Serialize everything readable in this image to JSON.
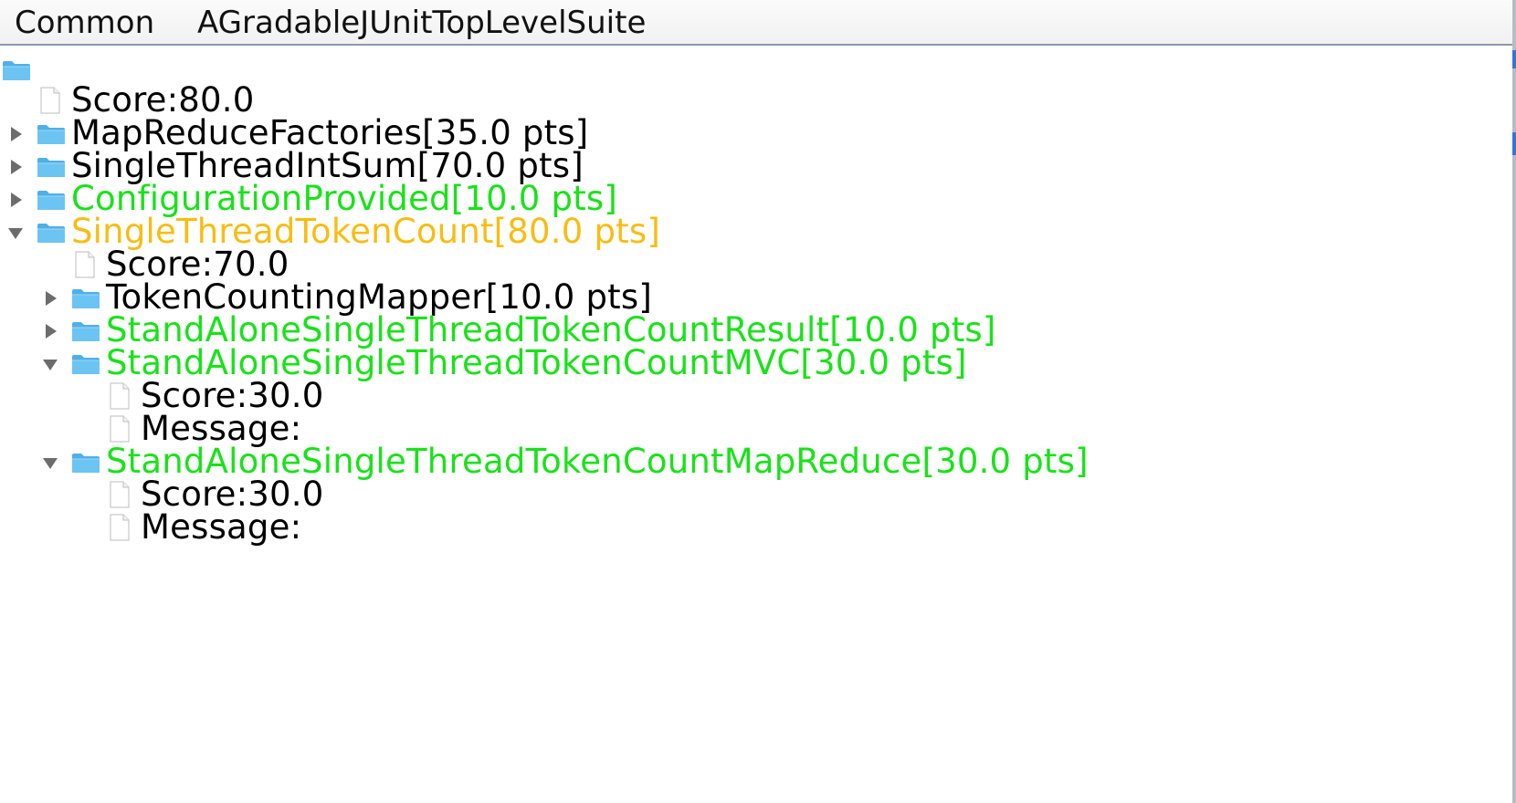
{
  "menubar": {
    "items": [
      "Common",
      "AGradableJUnitTopLevelSuite"
    ]
  },
  "colors": {
    "passed": "#19e219",
    "partial": "#f7bd12",
    "default": "#000000",
    "folder": "#5ab9ee"
  },
  "tree": {
    "root_label": "",
    "nodes": [
      {
        "label": "Score:80.0",
        "type": "file"
      },
      {
        "label": "MapReduceFactories[35.0 pts]",
        "type": "folder",
        "state": "collapsed"
      },
      {
        "label": "SingleThreadIntSum[70.0 pts]",
        "type": "folder",
        "state": "collapsed"
      },
      {
        "label": "ConfigurationProvided[10.0 pts]",
        "type": "folder",
        "state": "collapsed"
      },
      {
        "label": "SingleThreadTokenCount[80.0 pts]",
        "type": "folder",
        "state": "expanded"
      },
      {
        "label": "Score:70.0",
        "type": "file"
      },
      {
        "label": "TokenCountingMapper[10.0 pts]",
        "type": "folder",
        "state": "collapsed"
      },
      {
        "label": "StandAloneSingleThreadTokenCountResult[10.0 pts]",
        "type": "folder",
        "state": "collapsed"
      },
      {
        "label": "StandAloneSingleThreadTokenCountMVC[30.0 pts]",
        "type": "folder",
        "state": "expanded"
      },
      {
        "label": "Score:30.0",
        "type": "file"
      },
      {
        "label": "Message:",
        "type": "file"
      },
      {
        "label": "StandAloneSingleThreadTokenCountMapReduce[30.0 pts]",
        "type": "folder",
        "state": "expanded"
      },
      {
        "label": "Score:30.0",
        "type": "file"
      },
      {
        "label": "Message:",
        "type": "file"
      }
    ]
  }
}
